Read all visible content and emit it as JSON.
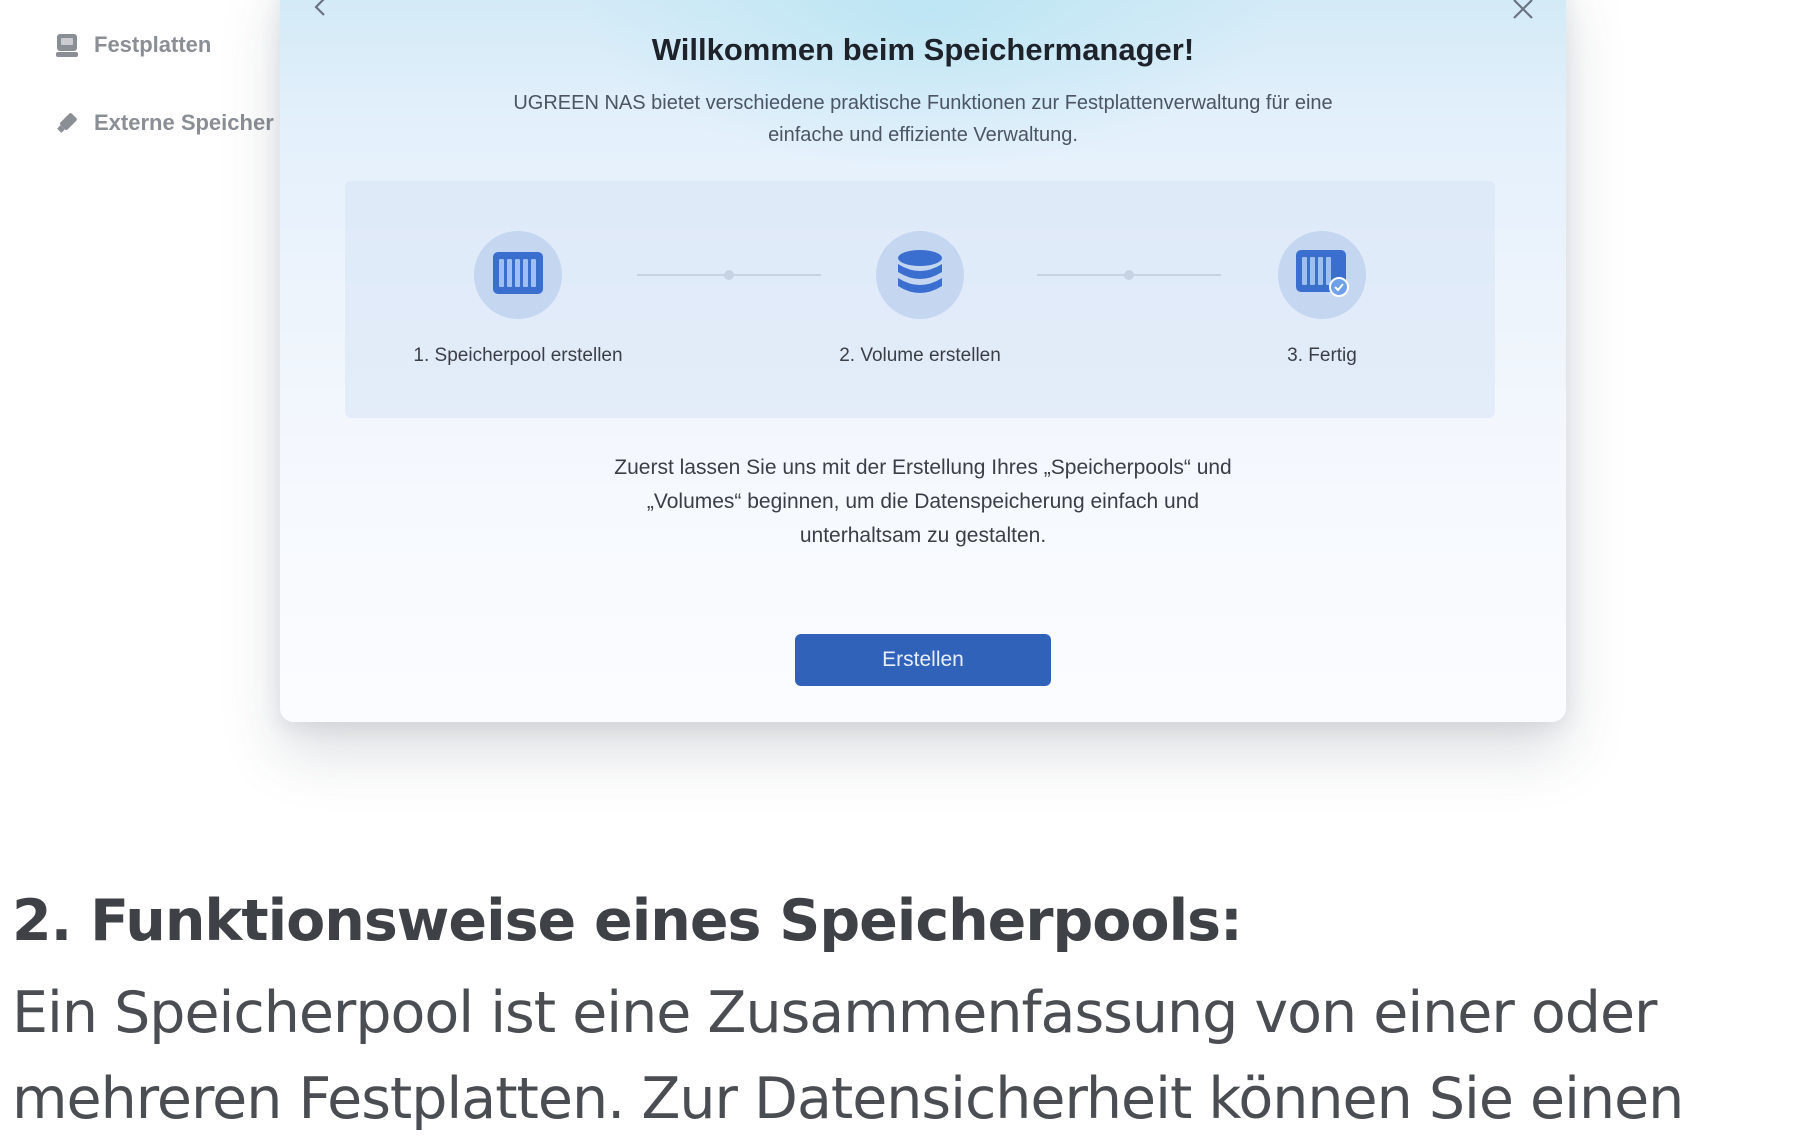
{
  "sidebar": {
    "items": [
      {
        "label": "Festplatten",
        "icon": "hard-drive-icon"
      },
      {
        "label": "Externe Speicher",
        "icon": "usb-stick-icon"
      }
    ]
  },
  "modal": {
    "title": "Willkommen beim Speichermanager!",
    "subtitle_line1": "UGREEN NAS bietet verschiedene praktische Funktionen zur Festplattenverwaltung für eine",
    "subtitle_line2": "einfache und effiziente Verwaltung.",
    "steps": [
      {
        "label": "1. Speicherpool erstellen",
        "icon": "storage-pool-icon"
      },
      {
        "label": "2. Volume erstellen",
        "icon": "database-icon"
      },
      {
        "label": "3. Fertig",
        "icon": "storage-pool-done-icon"
      }
    ],
    "description_line1": "Zuerst lassen Sie uns mit der Erstellung Ihres „Speicherpools“ und",
    "description_line2": "„Volumes“ beginnen, um die Datenspeicherung einfach und",
    "description_line3": "unterhaltsam zu gestalten.",
    "button_label": "Erstellen"
  },
  "article": {
    "heading": "2. Funktionsweise eines Speicherpools:",
    "paragraph_line1": "Ein Speicherpool ist eine Zusammenfassung von einer oder",
    "paragraph_line2": "mehreren Festplatten. Zur Datensicherheit können Sie einen"
  },
  "colors": {
    "accent": "#2f62b8",
    "step_circle": "#bed2ee",
    "icon_blue": "#3a6fd0"
  }
}
